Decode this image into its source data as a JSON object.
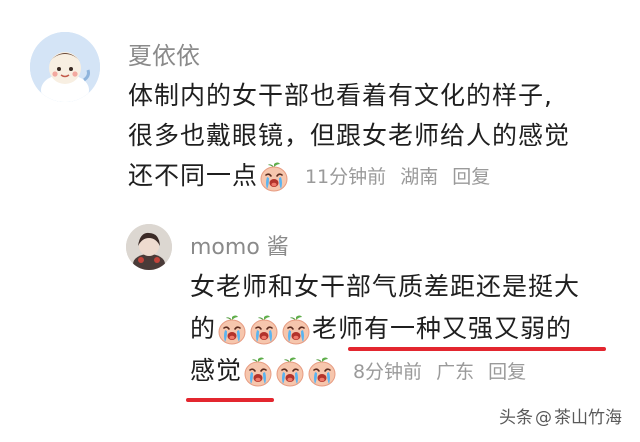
{
  "comments": [
    {
      "username": "夏依依",
      "lines": [
        "体制内的女干部也看着有文化的样子,",
        "很多也戴眼镜，但跟女老师给人的感觉",
        "还不同一点"
      ],
      "meta": {
        "time": "11分钟前",
        "location": "湖南",
        "reply": "回复"
      },
      "avatar_icon": "cartoon-avatar-icon",
      "emoji_icon": "crying-face-emoji-icon"
    },
    {
      "username": "momo 酱",
      "lines": [
        "女老师和女干部气质差距还是挺大",
        "的",
        "老师有一种又强又弱的",
        "感觉"
      ],
      "meta": {
        "time": "8分钟前",
        "location": "广东",
        "reply": "回复"
      },
      "avatar_icon": "photo-avatar-icon",
      "emoji_icon": "crying-face-emoji-icon"
    }
  ],
  "watermark": {
    "platform": "头条",
    "at": "@",
    "author": "茶山竹海"
  },
  "colors": {
    "text": "#1f1f1f",
    "meta": "#9a9a9a",
    "username": "#8a8a8a",
    "underline": "#e3262f"
  }
}
